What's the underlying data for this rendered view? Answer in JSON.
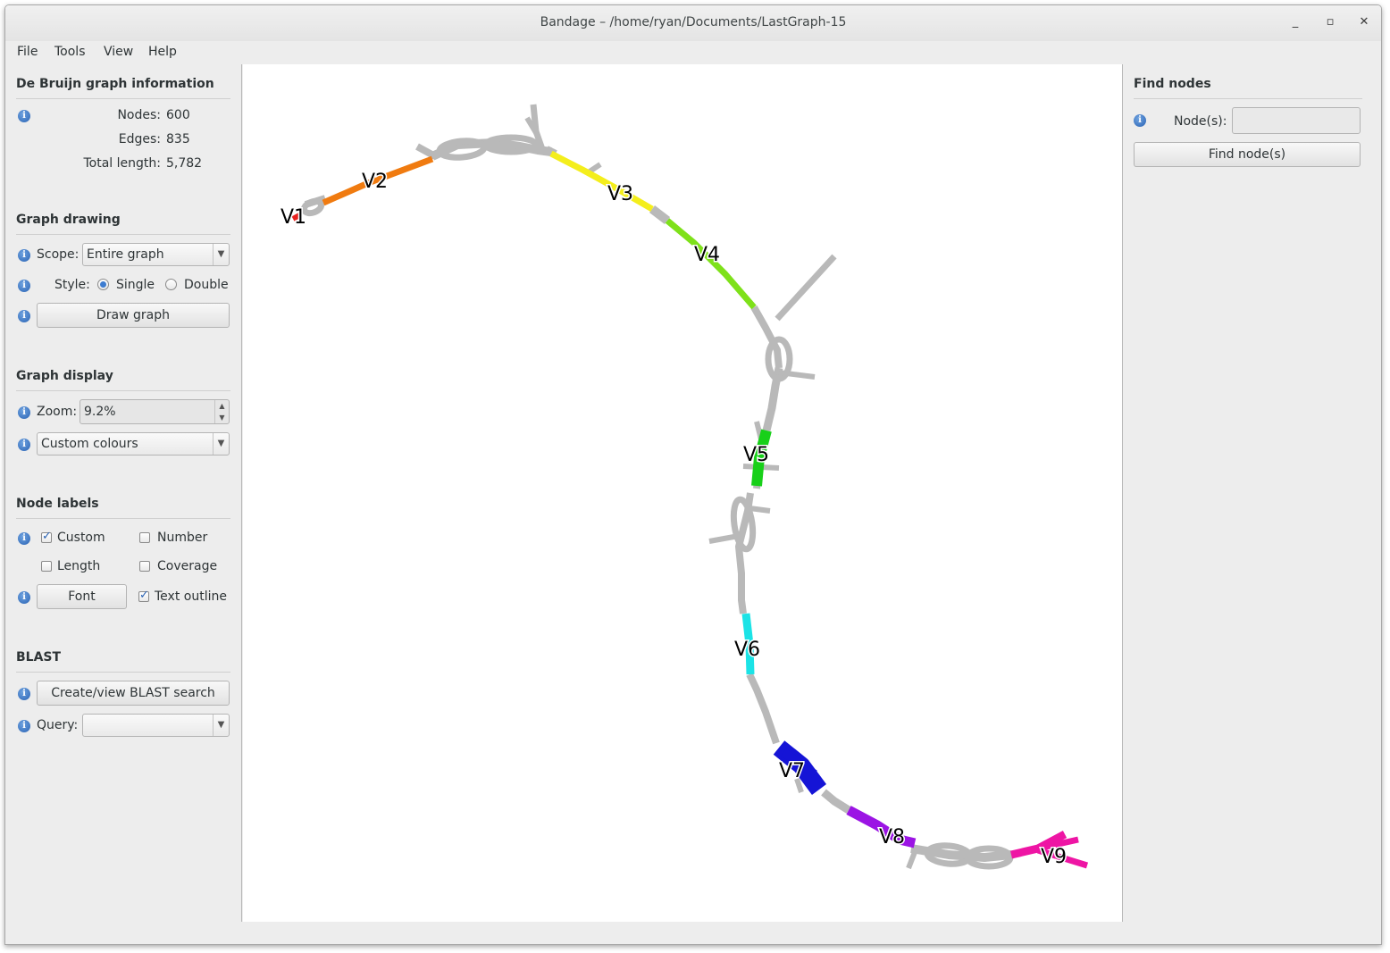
{
  "window": {
    "title": "Bandage – /home/ryan/Documents/LastGraph-15",
    "controls": {
      "minimize": "_",
      "maximize": "▫",
      "close": "✕"
    }
  },
  "menu": [
    "File",
    "Tools",
    "View",
    "Help"
  ],
  "graph_info": {
    "title": "De Bruijn graph information",
    "nodes_label": "Nodes:",
    "nodes_value": "600",
    "edges_label": "Edges:",
    "edges_value": "835",
    "length_label": "Total length:",
    "length_value": "5,782"
  },
  "graph_drawing": {
    "title": "Graph drawing",
    "scope_label": "Scope:",
    "scope_value": "Entire graph",
    "style_label": "Style:",
    "style_single": "Single",
    "style_double": "Double",
    "style_selected": "Single",
    "draw_button": "Draw graph"
  },
  "graph_display": {
    "title": "Graph display",
    "zoom_label": "Zoom:",
    "zoom_value": "9.2%",
    "colour_mode": "Custom colours"
  },
  "node_labels": {
    "title": "Node labels",
    "custom": "Custom",
    "custom_checked": true,
    "number": "Number",
    "number_checked": false,
    "length": "Length",
    "length_checked": false,
    "coverage": "Coverage",
    "coverage_checked": false,
    "font_button": "Font",
    "text_outline": "Text outline",
    "text_outline_checked": true
  },
  "blast": {
    "title": "BLAST",
    "search_button": "Create/view BLAST search",
    "query_label": "Query:",
    "query_value": ""
  },
  "find_nodes": {
    "title": "Find nodes",
    "nodes_label": "Node(s):",
    "nodes_value": "",
    "find_button": "Find node(s)"
  },
  "graph": {
    "labels": [
      "V1",
      "V2",
      "V3",
      "V4",
      "V5",
      "V6",
      "V7",
      "V8",
      "V9"
    ],
    "segment_colors": {
      "V1": "#e8211e",
      "V2": "#f07b10",
      "V3": "#f4ee1c",
      "V4": "#7ee11a",
      "V5": "#18d019",
      "V6": "#1be3e6",
      "V7": "#1514d6",
      "V8": "#9b14e4",
      "V9": "#ee15a4",
      "other": "#b9b9b9"
    }
  }
}
